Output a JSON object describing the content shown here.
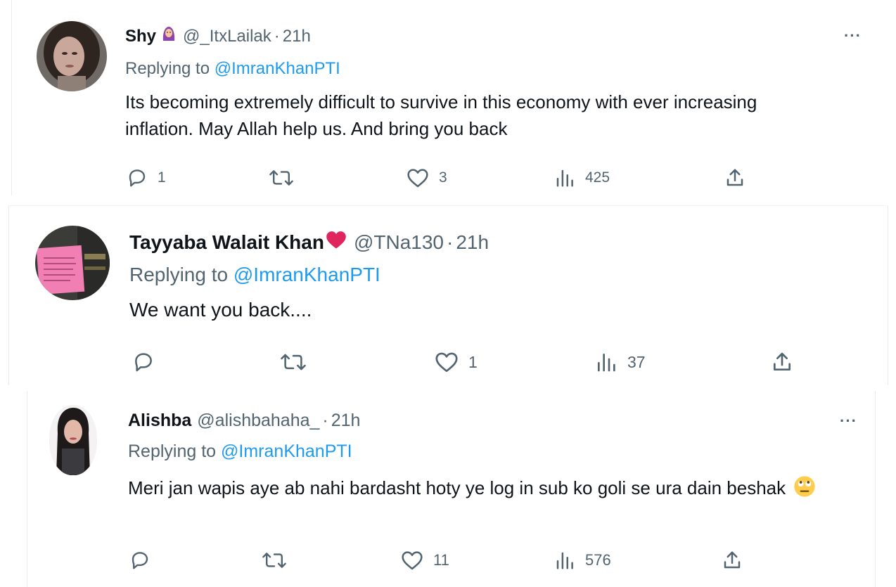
{
  "tweets": [
    {
      "name": "Shy",
      "handle": "@_ItxLailak",
      "separator": "·",
      "time": "21h",
      "replying_prefix": "Replying to",
      "replying_to": "@ImranKhanPTI",
      "text": "Its becoming extremely difficult to survive in this economy with ever increasing inflation. May Allah help us. And bring you back",
      "replies": "1",
      "retweets": "",
      "likes": "3",
      "views": "425",
      "more": "···"
    },
    {
      "name": "Tayyaba Walait Khan",
      "handle": "@TNa130",
      "separator": "·",
      "time": "21h",
      "replying_prefix": "Replying to",
      "replying_to": "@ImranKhanPTI",
      "text": "We want you back....",
      "replies": "",
      "retweets": "",
      "likes": "1",
      "views": "37"
    },
    {
      "name": "Alishba",
      "handle": "@alishbahaha_",
      "separator": "·",
      "time": "21h",
      "replying_prefix": "Replying to",
      "replying_to": "@ImranKhanPTI",
      "text": "Meri jan wapis aye ab nahi bardasht hoty ye log in sub ko goli se ura dain beshak",
      "replies": "",
      "retweets": "",
      "likes": "11",
      "views": "576",
      "more": "···"
    }
  ],
  "icons": {
    "reply": "reply-icon",
    "retweet": "retweet-icon",
    "like": "heart-icon",
    "views": "views-icon",
    "share": "share-icon"
  },
  "colors": {
    "link": "#1d9bf0",
    "secondary": "#536471",
    "primary": "#0f1419",
    "heart_emoji": "#e0245e"
  }
}
